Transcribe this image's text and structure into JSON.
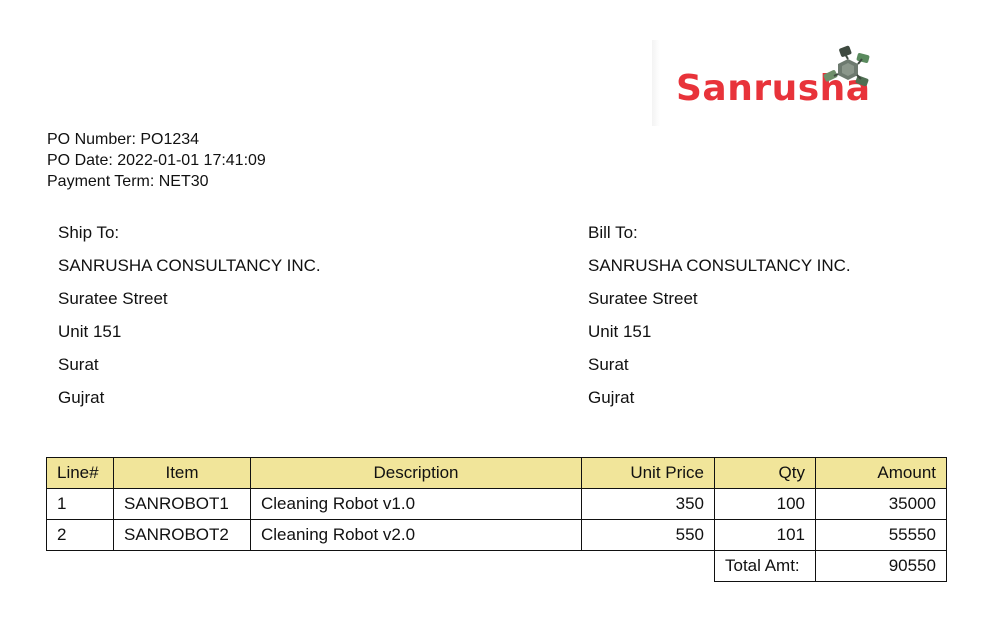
{
  "logo": {
    "text": "Sanrusha",
    "color": "#e8333a"
  },
  "po": {
    "number": "PO Number: PO1234",
    "date": "PO Date: 2022-01-01 17:41:09",
    "payment_term": "Payment Term: NET30"
  },
  "ship_to": {
    "heading": "Ship To:",
    "lines": [
      "SANRUSHA CONSULTANCY INC.",
      "Suratee Street",
      "Unit 151",
      "Surat",
      "Gujrat"
    ]
  },
  "bill_to": {
    "heading": "Bill To:",
    "lines": [
      "SANRUSHA CONSULTANCY INC.",
      "Suratee Street",
      "Unit 151",
      "Surat",
      "Gujrat"
    ]
  },
  "table": {
    "header_color": "#f1e59a",
    "columns": [
      "Line#",
      "Item",
      "Description",
      "Unit Price",
      "Qty",
      "Amount"
    ],
    "rows": [
      [
        "1",
        "SANROBOT1",
        "Cleaning Robot v1.0",
        "350",
        "100",
        "35000"
      ],
      [
        "2",
        "SANROBOT2",
        "Cleaning Robot v2.0",
        "550",
        "101",
        "55550"
      ]
    ],
    "total_label": "Total Amt:",
    "total_value": "90550"
  }
}
